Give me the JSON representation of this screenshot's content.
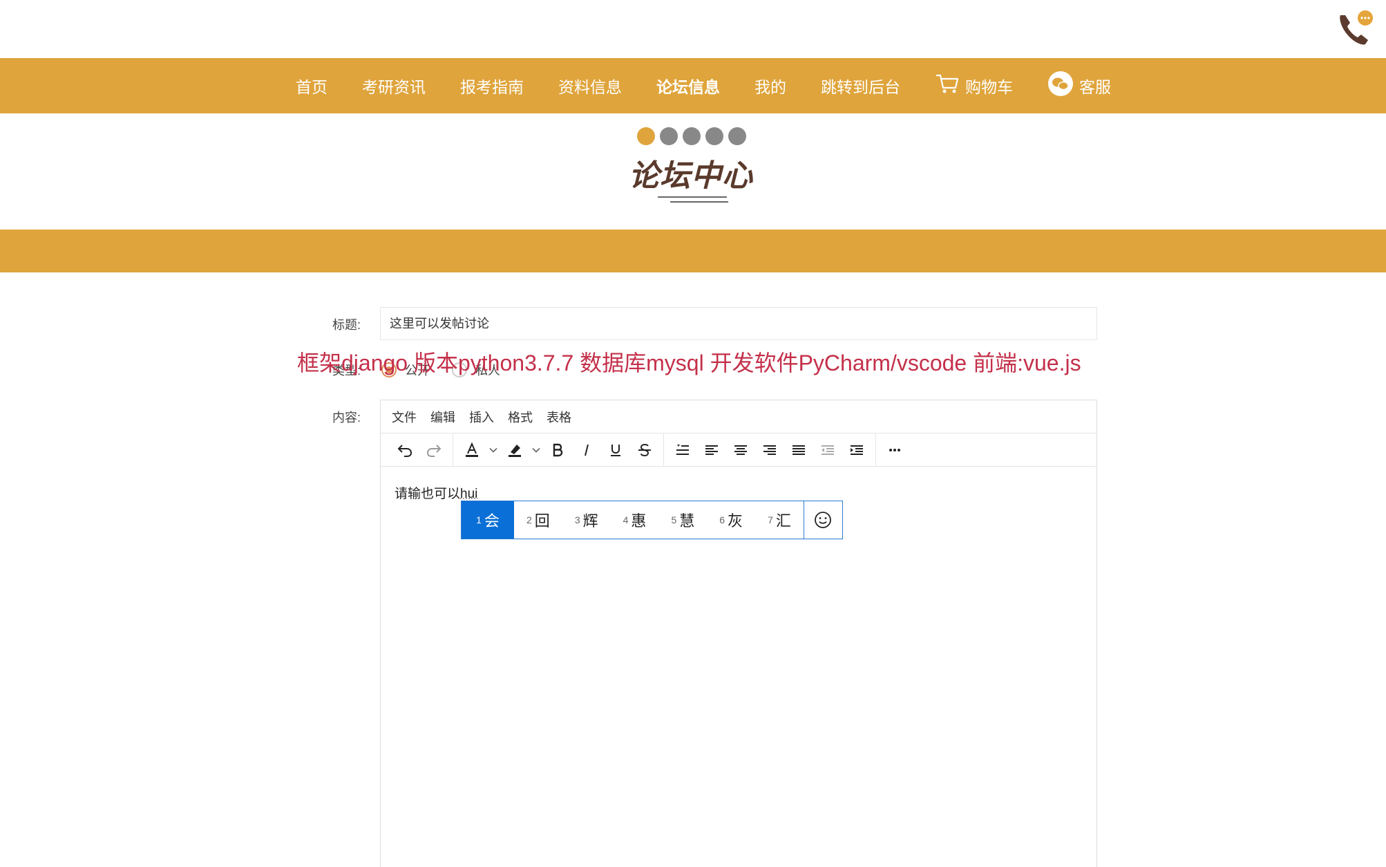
{
  "nav": {
    "items": [
      {
        "label": "首页"
      },
      {
        "label": "考研资讯"
      },
      {
        "label": "报考指南"
      },
      {
        "label": "资料信息"
      },
      {
        "label": "论坛信息",
        "active": true
      },
      {
        "label": "我的"
      },
      {
        "label": "跳转到后台"
      },
      {
        "label": "购物车",
        "icon": "cart-icon"
      },
      {
        "label": "客服",
        "icon": "wechat-icon"
      }
    ],
    "bg_color": "#dfa43b"
  },
  "hero": {
    "title": "论坛中心",
    "carousel_count": 5,
    "carousel_active": 1
  },
  "form": {
    "title_label": "标题:",
    "title_value": "这里可以发帖讨论",
    "type_label": "类型:",
    "type_options": [
      "公开",
      "私人"
    ],
    "type_selected": "公开",
    "content_label": "内容:"
  },
  "watermark": "框架django 版本python3.7.7 数据库mysql  开发软件PyCharm/vscode 前端:vue.js",
  "editor": {
    "menu": [
      "文件",
      "编辑",
      "插入",
      "格式",
      "表格"
    ],
    "toolbar_icons": [
      "undo-icon",
      "redo-icon",
      "font-color-icon",
      "highlight-icon",
      "bold-icon",
      "italic-icon",
      "underline-icon",
      "strikethrough-icon",
      "line-height-icon",
      "align-left-icon",
      "align-center-icon",
      "align-right-icon",
      "justify-icon",
      "outdent-icon",
      "indent-icon",
      "more-icon"
    ],
    "content_text": "请输也可以",
    "composing_text": "hui"
  },
  "ime": {
    "candidates": [
      {
        "num": "1",
        "char": "会"
      },
      {
        "num": "2",
        "char": "回"
      },
      {
        "num": "3",
        "char": "辉"
      },
      {
        "num": "4",
        "char": "惠"
      },
      {
        "num": "5",
        "char": "慧"
      },
      {
        "num": "6",
        "char": "灰"
      },
      {
        "num": "7",
        "char": "汇"
      }
    ],
    "selected": "1"
  }
}
